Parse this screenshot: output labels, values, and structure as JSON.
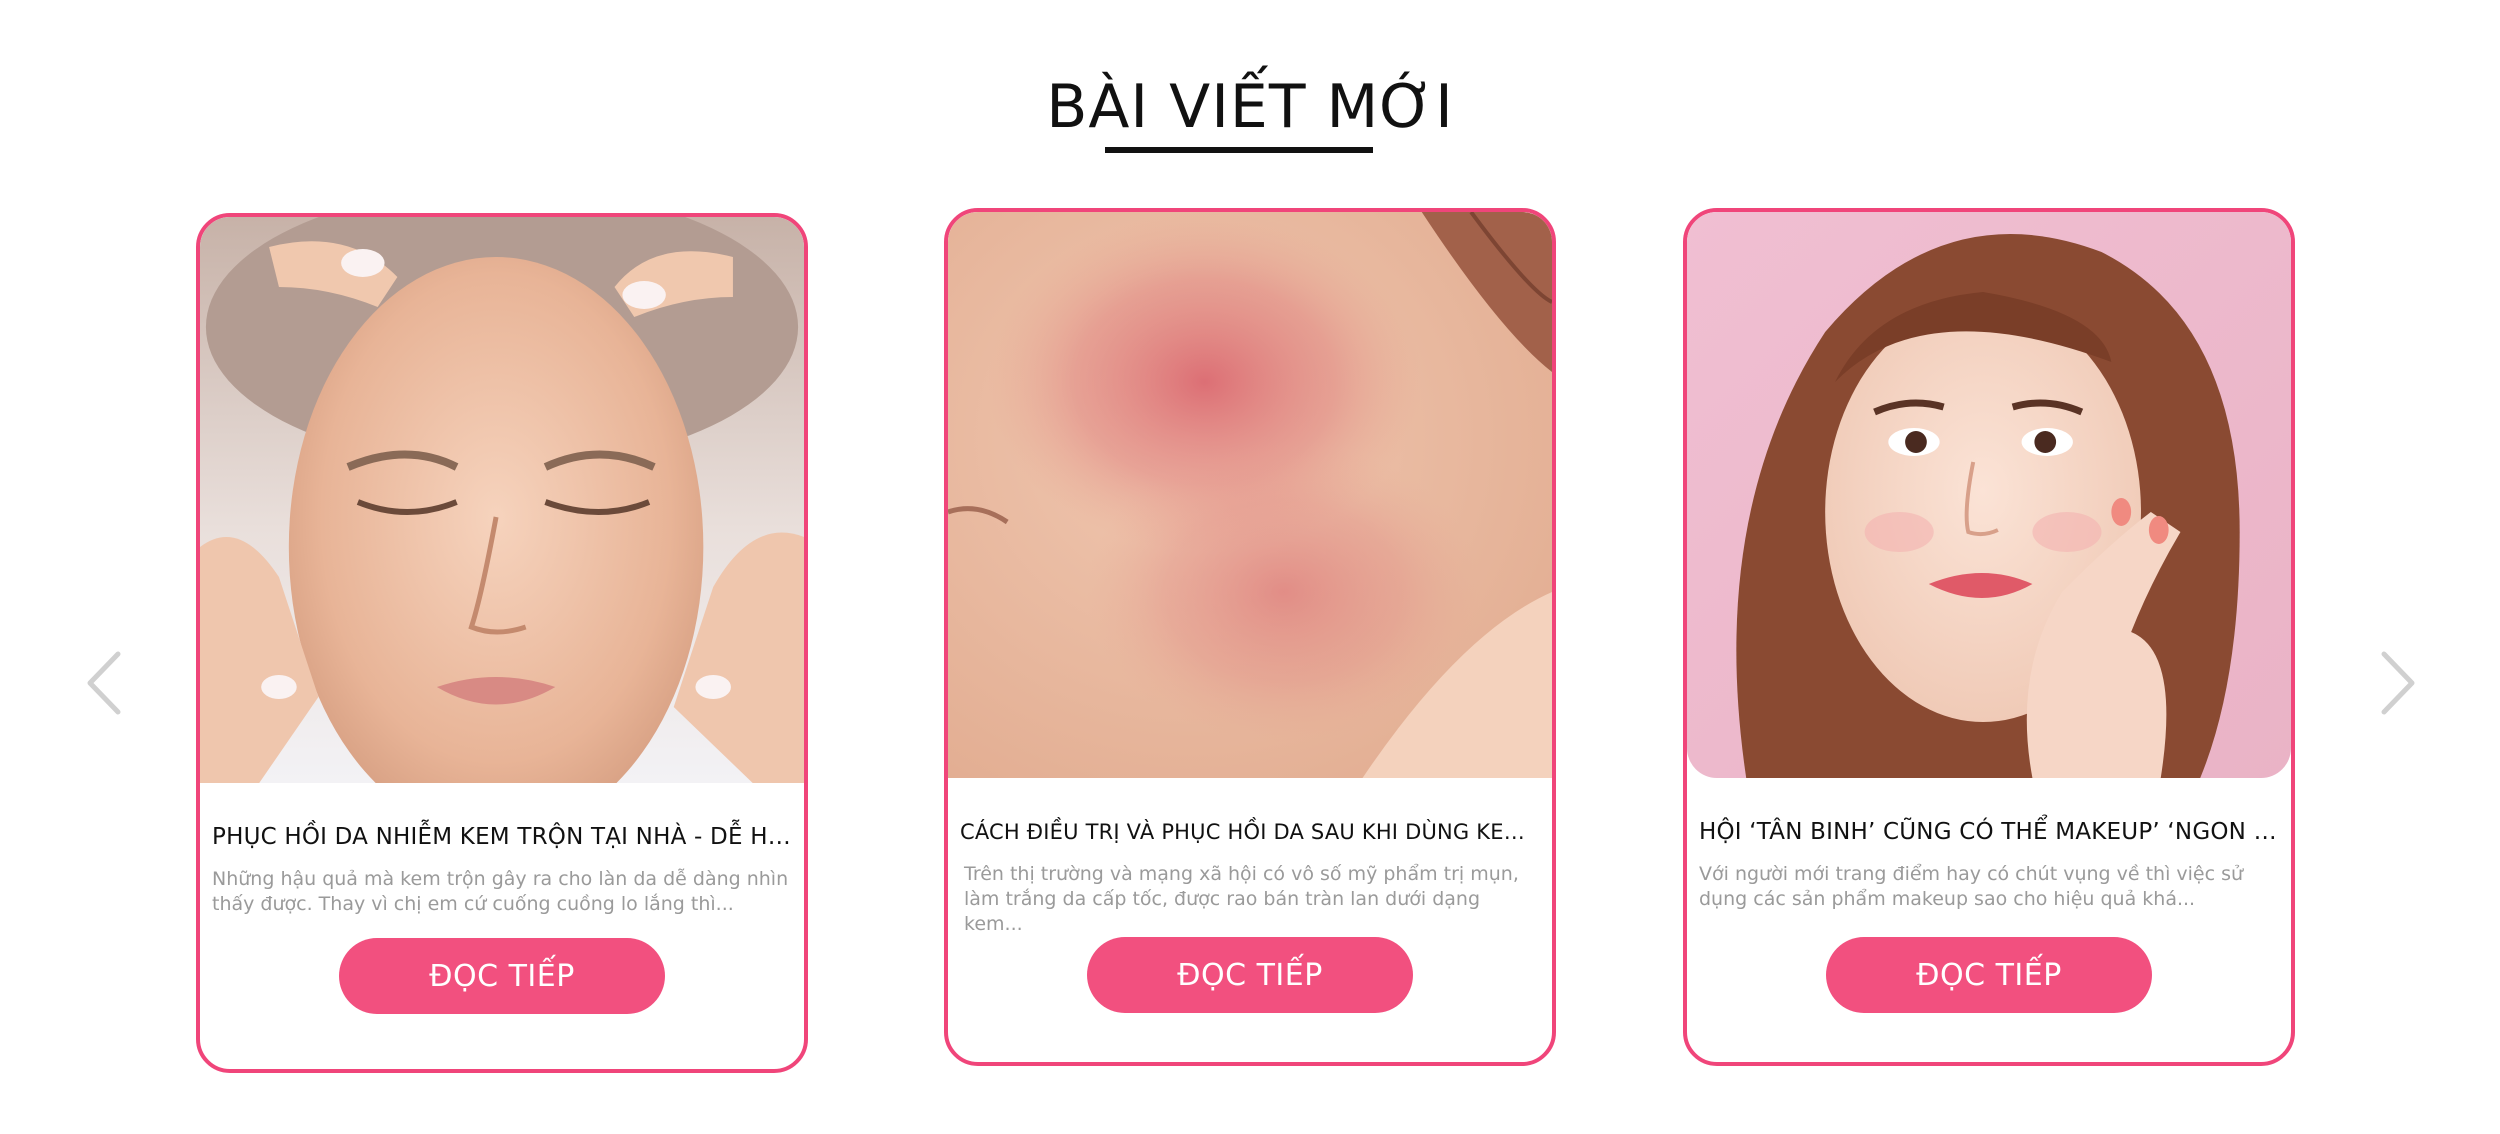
{
  "section": {
    "title": "BÀI VIẾT MỚI"
  },
  "nav": {
    "prev_icon": "chevron-left-icon",
    "next_icon": "chevron-right-icon",
    "arrow_color": "#d0d0d0"
  },
  "colors": {
    "accent": "#f2507f",
    "border": "#f0457a",
    "title": "#111111",
    "excerpt": "#9a9a9a"
  },
  "posts": [
    {
      "title": "PHỤC HỒI DA NHIỄM KEM TRỘN TẠI NHÀ - DỄ HAY KHÓ",
      "excerpt": "Những hậu quả mà kem trộn gây ra cho làn da dễ dàng nhìn thấy được. Thay vì chị em cứ cuống cuồng lo lắng thì...",
      "button": "ĐỌC TIẾP"
    },
    {
      "title": "CÁCH ĐIỀU TRỊ VÀ PHỤC HỒI DA SAU KHI DÙNG KEM TRỘN",
      "excerpt": "Trên thị trường và mạng xã hội có vô số mỹ phẩm trị mụn, làm trắng da cấp tốc, được rao bán tràn lan dưới dạng kem...",
      "button": "ĐỌC TIẾP"
    },
    {
      "title": "HỘI ‘TÂN BINH’ CŨNG CÓ THỂ MAKEUP’ ‘NGON LÀNH’...",
      "excerpt": "Với người mới trang điểm hay có chút vụng về thì việc sử dụng các sản phẩm makeup sao cho hiệu quả khá...",
      "button": "ĐỌC TIẾP"
    }
  ]
}
